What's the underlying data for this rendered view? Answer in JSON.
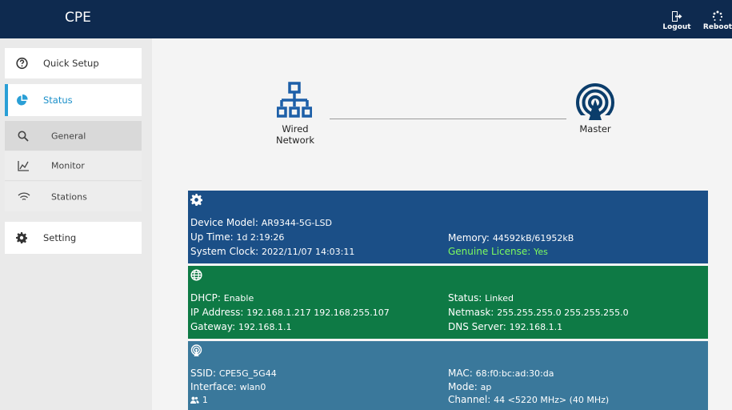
{
  "header": {
    "brand": "CPE",
    "logout_label": "Logout",
    "reboot_label": "Reboot"
  },
  "sidebar": {
    "quick_setup": "Quick Setup",
    "status": "Status",
    "general": "General",
    "monitor": "Monitor",
    "stations": "Stations",
    "setting": "Setting"
  },
  "diagram": {
    "wired_line1": "Wired",
    "wired_line2": "Network",
    "master": "Master"
  },
  "device": {
    "model_label": "Device Model:",
    "model": "AR9344-5G-LSD",
    "uptime_label": "Up Time:",
    "uptime": "1d 2:19:26",
    "clock_label": "System Clock:",
    "clock": "2022/11/07 14:03:11",
    "memory_label": "Memory:",
    "memory": "44592kB/61952kB",
    "license_label": "Genuine License:",
    "license": "Yes"
  },
  "network": {
    "dhcp_label": "DHCP:",
    "dhcp": "Enable",
    "ip_label": "IP Address:",
    "ip": "192.168.1.217 192.168.255.107",
    "gateway_label": "Gateway:",
    "gateway": "192.168.1.1",
    "status_label": "Status:",
    "status": "Linked",
    "netmask_label": "Netmask:",
    "netmask": "255.255.255.0 255.255.255.0",
    "dns_label": "DNS Server:",
    "dns": "192.168.1.1"
  },
  "wireless": {
    "ssid_label": "SSID:",
    "ssid": "CPE5G_5G44",
    "interface_label": "Interface:",
    "interface": "wlan0",
    "clients": "1",
    "mac_label": "MAC:",
    "mac": "68:f0:bc:ad:30:da",
    "mode_label": "Mode:",
    "mode": "ap",
    "channel_label": "Channel:",
    "channel": "44 <5220 MHz> (40 MHz)"
  },
  "colors": {
    "header": "#0e2a4f",
    "device_panel": "#1b4f87",
    "network_panel": "#0e7a45",
    "wireless_panel": "#3a789b",
    "accent": "#2a9fd6",
    "license_ok": "#7dfc5e"
  }
}
